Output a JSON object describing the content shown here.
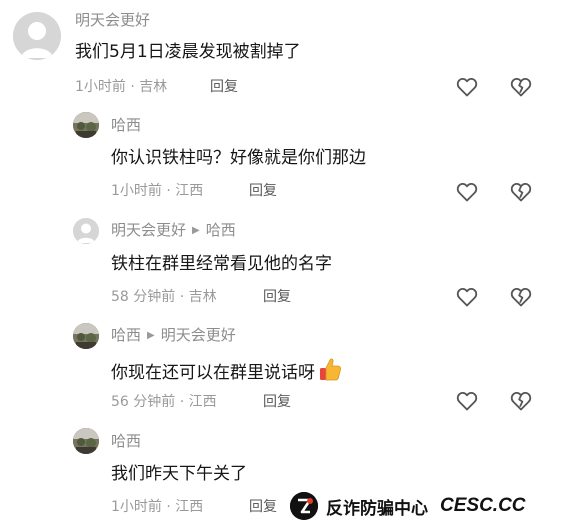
{
  "comments": [
    {
      "user": "明天会更好",
      "reply_to": "",
      "text": "我们5月1日凌晨发现被割掉了",
      "time_loc": "1小时前 · 吉林",
      "reply_label": "回复"
    },
    {
      "user": "哈西",
      "reply_to": "",
      "text": "你认识铁柱吗？好像就是你们那边",
      "time_loc": "1小时前 · 江西",
      "reply_label": "回复"
    },
    {
      "user": "明天会更好",
      "reply_to": "哈西",
      "text": "铁柱在群里经常看见他的名字",
      "time_loc": "58 分钟前 · 吉林",
      "reply_label": "回复"
    },
    {
      "user": "哈西",
      "reply_to": "明天会更好",
      "text": "你现在还可以在群里说话呀",
      "time_loc": "56 分钟前 · 江西",
      "reply_label": "回复"
    },
    {
      "user": "哈西",
      "reply_to": "",
      "text": "我们昨天下午关了",
      "time_loc": "1小时前 · 江西",
      "reply_label": "回复"
    }
  ],
  "watermark": {
    "text": "反诈防骗中心",
    "site": "CESC.CC"
  },
  "icons": {
    "like": "heart-outline-icon",
    "dislike": "broken-heart-icon",
    "emoji": "thumbs-up-emoji"
  },
  "colors": {
    "text": "#161616",
    "muted": "#9a9a9a",
    "icon": "#555555"
  }
}
